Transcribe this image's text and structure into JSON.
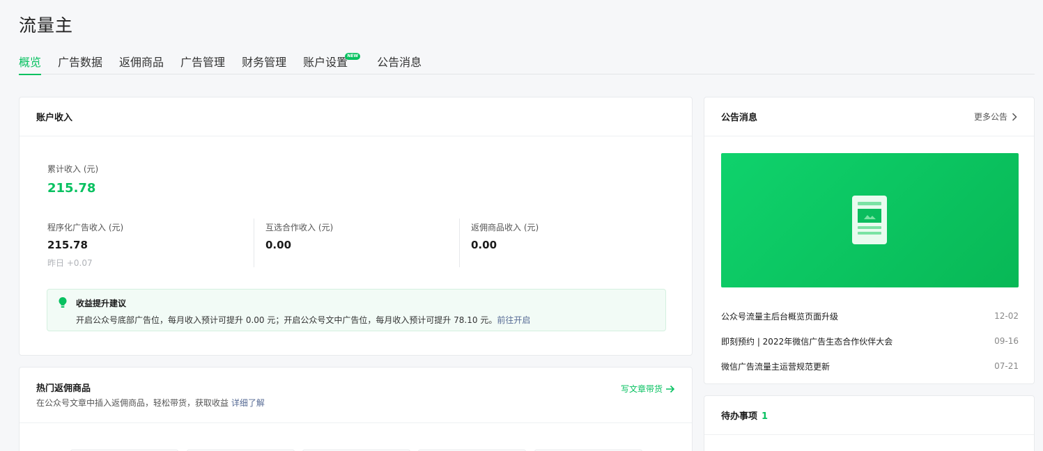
{
  "page": {
    "title": "流量主"
  },
  "tabs": [
    {
      "label": "概览"
    },
    {
      "label": "广告数据"
    },
    {
      "label": "返佣商品"
    },
    {
      "label": "广告管理"
    },
    {
      "label": "财务管理"
    },
    {
      "label": "账户设置",
      "badge": "NEW"
    },
    {
      "label": "公告消息"
    }
  ],
  "income": {
    "title": "账户收入",
    "total_label": "累计收入 (元)",
    "total_value": "215.78",
    "items": [
      {
        "label": "程序化广告收入 (元)",
        "value": "215.78",
        "note": "昨日 +0.07"
      },
      {
        "label": "互选合作收入 (元)",
        "value": "0.00"
      },
      {
        "label": "返佣商品收入 (元)",
        "value": "0.00"
      }
    ],
    "tip": {
      "title": "收益提升建议",
      "text": "开启公众号底部广告位，每月收入预计可提升 0.00 元；开启公众号文中广告位，每月收入预计可提升 78.10 元。",
      "link": "前往开启"
    }
  },
  "hot_products": {
    "title": "热门返佣商品",
    "subtitle": "在公众号文章中插入返佣商品，轻松带货，获取收益",
    "subtitle_link": "详细了解",
    "action": "写文章带货"
  },
  "notices": {
    "title": "公告消息",
    "more": "更多公告",
    "items": [
      {
        "title": "公众号流量主后台概览页面升级",
        "date": "12-02"
      },
      {
        "title": "即刻预约 | 2022年微信广告生态合作伙伴大会",
        "date": "09-16"
      },
      {
        "title": "微信广告流量主运营规范更新",
        "date": "07-21"
      }
    ]
  },
  "todo": {
    "title": "待办事项",
    "count": "1"
  },
  "colors": {
    "accent": "#07c160",
    "link": "#576b95",
    "background": "#f6f7f9"
  }
}
